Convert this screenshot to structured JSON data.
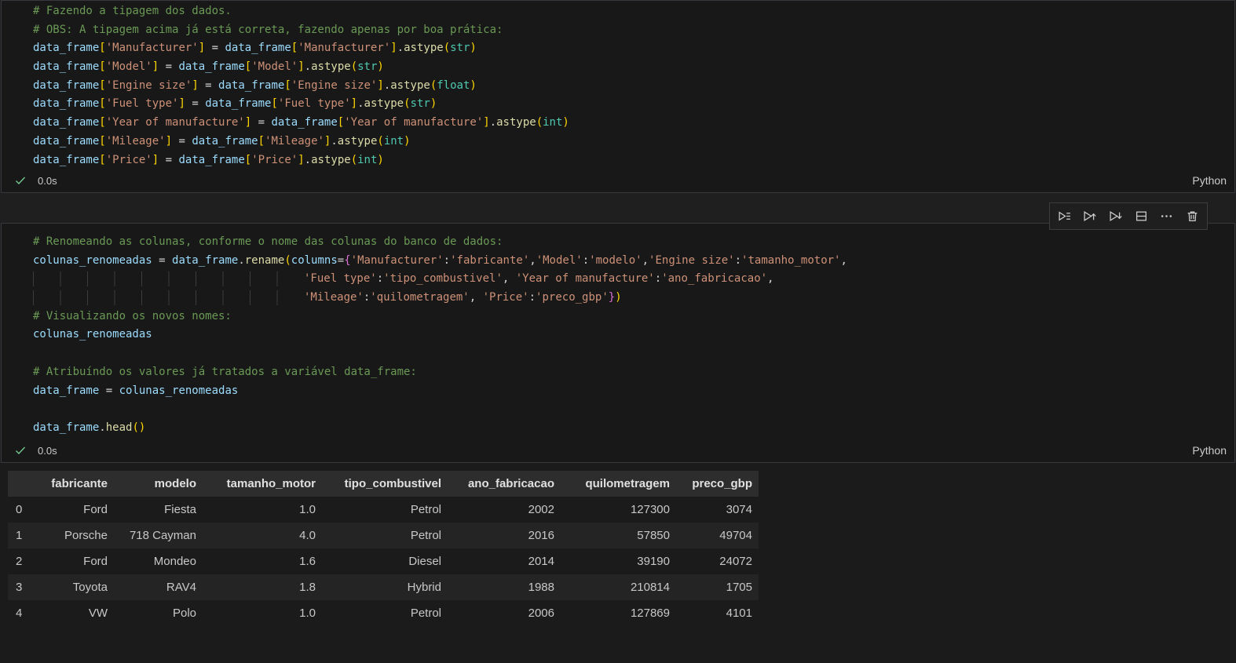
{
  "colors": {
    "background": "#1f1f1f",
    "cell_background": "#181818",
    "cell_border": "#37373d",
    "comment": "#6A9955",
    "variable": "#9CDCFE",
    "string": "#CE9178",
    "function": "#DCDCAA",
    "type": "#4EC9B0",
    "bracket_level1": "#FFD700",
    "bracket_level2": "#DA70D6",
    "operator": "#D4D4D4",
    "success_check": "#73C991",
    "table_header_bg": "#2d2d2d",
    "table_alt_row_bg": "#242424"
  },
  "cell1": {
    "lines": [
      [
        [
          "com",
          "# Fazendo a tipagem dos dados."
        ]
      ],
      [
        [
          "com",
          "# OBS: A tipagem acima já está correta, fazendo apenas por boa prática:"
        ]
      ],
      [
        [
          "var",
          "data_frame"
        ],
        [
          "b1",
          "["
        ],
        [
          "str",
          "'Manufacturer'"
        ],
        [
          "b1",
          "]"
        ],
        [
          "op",
          " = "
        ],
        [
          "var",
          "data_frame"
        ],
        [
          "b1",
          "["
        ],
        [
          "str",
          "'Manufacturer'"
        ],
        [
          "b1",
          "]"
        ],
        [
          "op",
          "."
        ],
        [
          "fn",
          "astype"
        ],
        [
          "b1",
          "("
        ],
        [
          "type",
          "str"
        ],
        [
          "b1",
          ")"
        ]
      ],
      [
        [
          "var",
          "data_frame"
        ],
        [
          "b1",
          "["
        ],
        [
          "str",
          "'Model'"
        ],
        [
          "b1",
          "]"
        ],
        [
          "op",
          " = "
        ],
        [
          "var",
          "data_frame"
        ],
        [
          "b1",
          "["
        ],
        [
          "str",
          "'Model'"
        ],
        [
          "b1",
          "]"
        ],
        [
          "op",
          "."
        ],
        [
          "fn",
          "astype"
        ],
        [
          "b1",
          "("
        ],
        [
          "type",
          "str"
        ],
        [
          "b1",
          ")"
        ]
      ],
      [
        [
          "var",
          "data_frame"
        ],
        [
          "b1",
          "["
        ],
        [
          "str",
          "'Engine size'"
        ],
        [
          "b1",
          "]"
        ],
        [
          "op",
          " = "
        ],
        [
          "var",
          "data_frame"
        ],
        [
          "b1",
          "["
        ],
        [
          "str",
          "'Engine size'"
        ],
        [
          "b1",
          "]"
        ],
        [
          "op",
          "."
        ],
        [
          "fn",
          "astype"
        ],
        [
          "b1",
          "("
        ],
        [
          "type",
          "float"
        ],
        [
          "b1",
          ")"
        ]
      ],
      [
        [
          "var",
          "data_frame"
        ],
        [
          "b1",
          "["
        ],
        [
          "str",
          "'Fuel type'"
        ],
        [
          "b1",
          "]"
        ],
        [
          "op",
          " = "
        ],
        [
          "var",
          "data_frame"
        ],
        [
          "b1",
          "["
        ],
        [
          "str",
          "'Fuel type'"
        ],
        [
          "b1",
          "]"
        ],
        [
          "op",
          "."
        ],
        [
          "fn",
          "astype"
        ],
        [
          "b1",
          "("
        ],
        [
          "type",
          "str"
        ],
        [
          "b1",
          ")"
        ]
      ],
      [
        [
          "var",
          "data_frame"
        ],
        [
          "b1",
          "["
        ],
        [
          "str",
          "'Year of manufacture'"
        ],
        [
          "b1",
          "]"
        ],
        [
          "op",
          " = "
        ],
        [
          "var",
          "data_frame"
        ],
        [
          "b1",
          "["
        ],
        [
          "str",
          "'Year of manufacture'"
        ],
        [
          "b1",
          "]"
        ],
        [
          "op",
          "."
        ],
        [
          "fn",
          "astype"
        ],
        [
          "b1",
          "("
        ],
        [
          "type",
          "int"
        ],
        [
          "b1",
          ")"
        ]
      ],
      [
        [
          "var",
          "data_frame"
        ],
        [
          "b1",
          "["
        ],
        [
          "str",
          "'Mileage'"
        ],
        [
          "b1",
          "]"
        ],
        [
          "op",
          " = "
        ],
        [
          "var",
          "data_frame"
        ],
        [
          "b1",
          "["
        ],
        [
          "str",
          "'Mileage'"
        ],
        [
          "b1",
          "]"
        ],
        [
          "op",
          "."
        ],
        [
          "fn",
          "astype"
        ],
        [
          "b1",
          "("
        ],
        [
          "type",
          "int"
        ],
        [
          "b1",
          ")"
        ]
      ],
      [
        [
          "var",
          "data_frame"
        ],
        [
          "b1",
          "["
        ],
        [
          "str",
          "'Price'"
        ],
        [
          "b1",
          "]"
        ],
        [
          "op",
          " = "
        ],
        [
          "var",
          "data_frame"
        ],
        [
          "b1",
          "["
        ],
        [
          "str",
          "'Price'"
        ],
        [
          "b1",
          "]"
        ],
        [
          "op",
          "."
        ],
        [
          "fn",
          "astype"
        ],
        [
          "b1",
          "("
        ],
        [
          "type",
          "int"
        ],
        [
          "b1",
          ")"
        ]
      ]
    ],
    "footer": {
      "duration": "0.0s",
      "language": "Python"
    }
  },
  "cell_toolbar": {
    "icons": [
      "run-by-line-icon",
      "execute-above-icon",
      "execute-below-icon",
      "split-cell-icon",
      "more-actions-icon",
      "delete-cell-icon"
    ]
  },
  "cell2": {
    "lines": [
      [
        [
          "com",
          "# Renomeando as colunas, conforme o nome das colunas do banco de dados:"
        ]
      ],
      [
        [
          "var",
          "colunas_renomeadas"
        ],
        [
          "op",
          " = "
        ],
        [
          "var",
          "data_frame"
        ],
        [
          "op",
          "."
        ],
        [
          "fn",
          "rename"
        ],
        [
          "b1",
          "("
        ],
        [
          "var",
          "columns"
        ],
        [
          "op",
          "="
        ],
        [
          "b2",
          "{"
        ],
        [
          "str",
          "'Manufacturer'"
        ],
        [
          "op",
          ":"
        ],
        [
          "str",
          "'fabricante'"
        ],
        [
          "op",
          ","
        ],
        [
          "str",
          "'Model'"
        ],
        [
          "op",
          ":"
        ],
        [
          "str",
          "'modelo'"
        ],
        [
          "op",
          ","
        ],
        [
          "str",
          "'Engine size'"
        ],
        [
          "op",
          ":"
        ],
        [
          "str",
          "'tamanho_motor'"
        ],
        [
          "op",
          ","
        ]
      ],
      [
        [
          "ind",
          ""
        ],
        [
          "str",
          "'Fuel type'"
        ],
        [
          "op",
          ":"
        ],
        [
          "str",
          "'tipo_combustivel'"
        ],
        [
          "op",
          ", "
        ],
        [
          "str",
          "'Year of manufacture'"
        ],
        [
          "op",
          ":"
        ],
        [
          "str",
          "'ano_fabricacao'"
        ],
        [
          "op",
          ","
        ]
      ],
      [
        [
          "ind",
          ""
        ],
        [
          "str",
          "'Mileage'"
        ],
        [
          "op",
          ":"
        ],
        [
          "str",
          "'quilometragem'"
        ],
        [
          "op",
          ", "
        ],
        [
          "str",
          "'Price'"
        ],
        [
          "op",
          ":"
        ],
        [
          "str",
          "'preco_gbp'"
        ],
        [
          "b2",
          "}"
        ],
        [
          "b1",
          ")"
        ]
      ],
      [
        [
          "com",
          "# Visualizando os novos nomes:"
        ]
      ],
      [
        [
          "var",
          "colunas_renomeadas"
        ]
      ],
      [],
      [
        [
          "com",
          "# Atribuíndo os valores já tratados a variável data_frame:"
        ]
      ],
      [
        [
          "var",
          "data_frame"
        ],
        [
          "op",
          " = "
        ],
        [
          "var",
          "colunas_renomeadas"
        ]
      ],
      [],
      [
        [
          "var",
          "data_frame"
        ],
        [
          "op",
          "."
        ],
        [
          "fn",
          "head"
        ],
        [
          "b1",
          "("
        ],
        [
          "b1",
          ")"
        ]
      ]
    ],
    "footer": {
      "duration": "0.0s",
      "language": "Python"
    }
  },
  "output_table": {
    "columns": [
      "",
      "fabricante",
      "modelo",
      "tamanho_motor",
      "tipo_combustivel",
      "ano_fabricacao",
      "quilometragem",
      "preco_gbp"
    ],
    "rows": [
      [
        "0",
        "Ford",
        "Fiesta",
        "1.0",
        "Petrol",
        "2002",
        "127300",
        "3074"
      ],
      [
        "1",
        "Porsche",
        "718 Cayman",
        "4.0",
        "Petrol",
        "2016",
        "57850",
        "49704"
      ],
      [
        "2",
        "Ford",
        "Mondeo",
        "1.6",
        "Diesel",
        "2014",
        "39190",
        "24072"
      ],
      [
        "3",
        "Toyota",
        "RAV4",
        "1.8",
        "Hybrid",
        "1988",
        "210814",
        "1705"
      ],
      [
        "4",
        "VW",
        "Polo",
        "1.0",
        "Petrol",
        "2006",
        "127869",
        "4101"
      ]
    ]
  }
}
